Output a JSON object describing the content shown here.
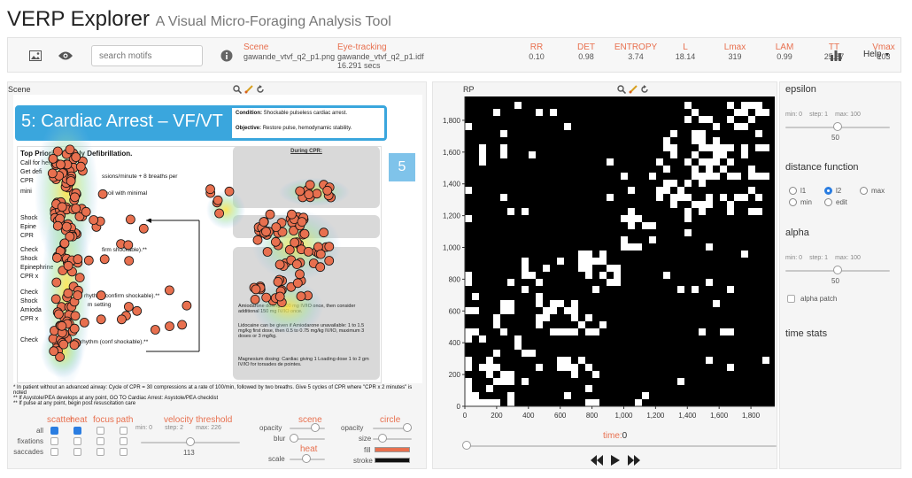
{
  "header": {
    "title": "VERP Explorer",
    "subtitle": "A Visual Micro-Foraging Analysis Tool"
  },
  "toolbar": {
    "search_placeholder": "search motifs",
    "scene_label": "Scene",
    "scene_file": "gawande_vtvf_q2_p1.png",
    "eye_label": "Eye-tracking",
    "eye_file": "gawande_vtvf_q2_p1.idf",
    "eye_duration": "16.291 secs",
    "metrics": [
      {
        "label": "RR",
        "value": "0.10"
      },
      {
        "label": "DET",
        "value": "0.98"
      },
      {
        "label": "ENTROPY",
        "value": "3.74"
      },
      {
        "label": "L",
        "value": "18.14"
      },
      {
        "label": "Lmax",
        "value": "319"
      },
      {
        "label": "LAM",
        "value": "0.99"
      },
      {
        "label": "TT",
        "value": "25.87"
      },
      {
        "label": "Vmax",
        "value": "103"
      }
    ],
    "help": "Help"
  },
  "scene": {
    "panel_title": "Scene",
    "slide_title": "5: Cardiac Arrest – VF/VT",
    "condition_label": "Condition:",
    "condition_text": "Shockable pulseless cardiac arrest.",
    "objective_label": "Objective:",
    "objective_text": "Restore pulse, hemodynamic stability.",
    "badge": "5",
    "priority": "Top Priority = Early Defibrillation.",
    "left_items": [
      "Call for help",
      "Get defi",
      "CPR",
      "mini",
      "Shock",
      "Epine",
      "CPR",
      "Check",
      "Shock",
      "Epinephrine",
      "CPR x",
      "Check",
      "Shock",
      "Amioda",
      "CPR x",
      "Check"
    ],
    "frag_a": "ssions/minute + 8 breaths per",
    "frag_b": "recoil with minimal",
    "frag_c": "firm shockable).**",
    "frag_d": "rhythm (confirm shockable).**",
    "frag_e": "m setting",
    "frag_f": "rhythm (conf shockable).**",
    "during_cpr": "During CPR:",
    "footnote1": "* In patient without an advanced airway: Cycle of CPR = 30 compressions at a rate of 100/min, followed by two breaths. Give 5 cycles of CPR where \"CPR x 2 minutes\" is noted",
    "footnote2": "** If Asystole/PEA develops at any point, GO TO Cardiac Arrest: Asystole/PEA checklist",
    "footnote3": "** If pulse at any point, begin post resuscitation care",
    "amio_text": "Amiodarone dosing: 300 mg IV/IO once, then consider additional 150 mg IV/IO once.",
    "lido_text": "Lidocaine can be given if Amiodarone unavailable: 1 to 1.5 mg/kg first dose, then 0.5 to 0.75 mg/kg IV/IO, maximum 3 doses or 3 mg/kg.",
    "mag_text": "Magnesium dosing: Cardiac giving 1 Loading dose 1 to 2 gm IV/IO for torsades de pointes."
  },
  "controls": {
    "col_headers": [
      "scatter",
      "heat",
      "focus",
      "path"
    ],
    "rows": [
      "all",
      "fixations",
      "saccades"
    ],
    "checked": [
      [
        true,
        true,
        false,
        false
      ],
      [
        false,
        false,
        false,
        false
      ],
      [
        false,
        false,
        false,
        false
      ]
    ],
    "velocity": {
      "label": "velocity threshold",
      "min": "min: 0",
      "step": "step: 2",
      "max": "max: 226",
      "value": "113",
      "fraction": 0.5
    },
    "scene_ctrl": {
      "label": "scene",
      "opacity": "opacity",
      "blur": "blur",
      "heat": "heat",
      "scale": "scale"
    },
    "circle_ctrl": {
      "label": "circle",
      "opacity": "opacity",
      "size": "size",
      "fill": "fill",
      "stroke": "stroke"
    },
    "fill_color": "#e8704f",
    "stroke_color": "#111111"
  },
  "rp": {
    "panel_title": "RP",
    "y_ticks": [
      "1,800",
      "1,600",
      "1,400",
      "1,200",
      "1,000",
      "800",
      "600",
      "400",
      "200",
      "0"
    ],
    "x_ticks": [
      "0",
      "200",
      "400",
      "600",
      "800",
      "1,000",
      "1,200",
      "1,400",
      "1,600",
      "1,800"
    ],
    "time_label": "time:",
    "time_value": "0"
  },
  "right": {
    "epsilon": {
      "title": "epsilon",
      "min": "min: 0",
      "step": "step: 1",
      "max": "max: 100",
      "value": "50",
      "fraction": 0.5
    },
    "distance": {
      "title": "distance function",
      "options": [
        "l1",
        "l2",
        "max",
        "min",
        "edit"
      ],
      "selected": "l2"
    },
    "alpha": {
      "title": "alpha",
      "min": "min: 0",
      "step": "step: 1",
      "max": "max: 100",
      "value": "50",
      "fraction": 0.5,
      "patch": "alpha patch"
    },
    "time_stats": "time stats"
  },
  "colors": {
    "accent": "#e8704f",
    "slide_blue": "#3aa6dd",
    "badge_blue": "#7fc3ea"
  }
}
